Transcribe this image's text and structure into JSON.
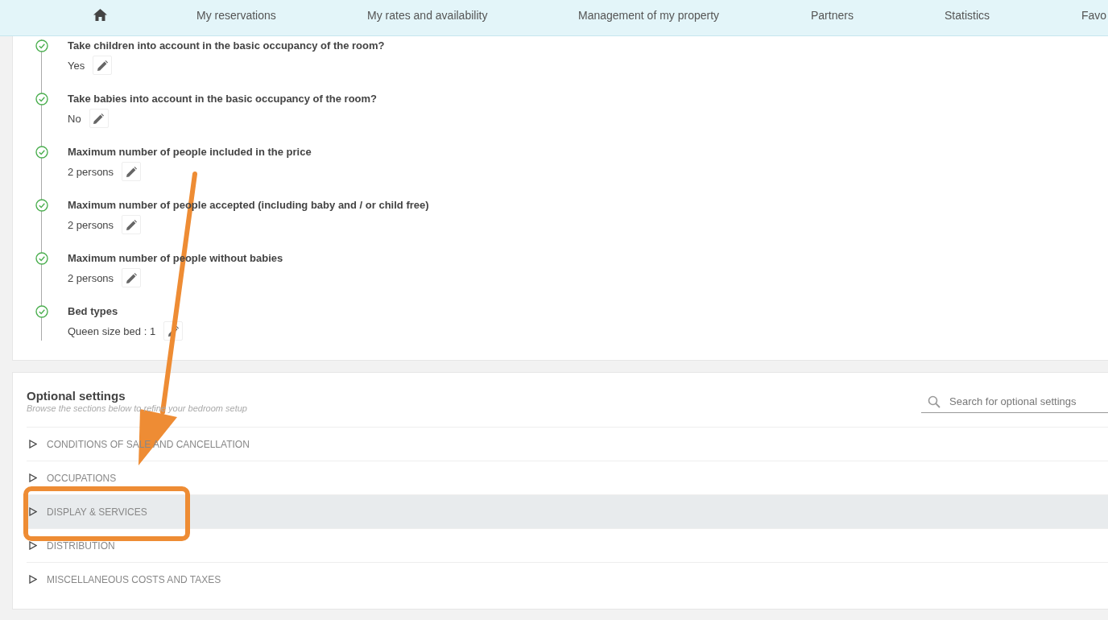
{
  "nav": {
    "items": [
      {
        "kind": "home"
      },
      {
        "kind": "text",
        "label": "My reservations"
      },
      {
        "kind": "text",
        "label": "My rates and availability"
      },
      {
        "kind": "text",
        "label": "Management of my property"
      },
      {
        "kind": "text",
        "label": "Partners"
      },
      {
        "kind": "text",
        "label": "Statistics"
      },
      {
        "kind": "text",
        "label": "Favo"
      }
    ]
  },
  "settings": [
    {
      "title": "Take children into account in the basic occupancy of the room?",
      "value": "Yes",
      "done": true
    },
    {
      "title": "Take babies into account in the basic occupancy of the room?",
      "value": "No",
      "done": true
    },
    {
      "title": "Maximum number of people included in the price",
      "value": "2 persons",
      "done": true
    },
    {
      "title": "Maximum number of people accepted (including baby and / or child free)",
      "value": "2 persons",
      "done": true
    },
    {
      "title": "Maximum number of people without babies",
      "value": "2 persons",
      "done": true
    },
    {
      "title": "Bed types",
      "value": "Queen size bed : 1",
      "done": true
    }
  ],
  "optional": {
    "title": "Optional settings",
    "subtitle": "Browse the sections below to refine your bedroom setup",
    "search": {
      "placeholder": "Search for optional settings"
    },
    "sections": [
      {
        "label": "CONDITIONS OF SALE AND CANCELLATION",
        "selected": false
      },
      {
        "label": "OCCUPATIONS",
        "selected": false
      },
      {
        "label": "DISPLAY & SERVICES",
        "selected": true
      },
      {
        "label": "DISTRIBUTION",
        "selected": false
      },
      {
        "label": "MISCELLANEOUS COSTS AND TAXES",
        "selected": false
      }
    ]
  }
}
